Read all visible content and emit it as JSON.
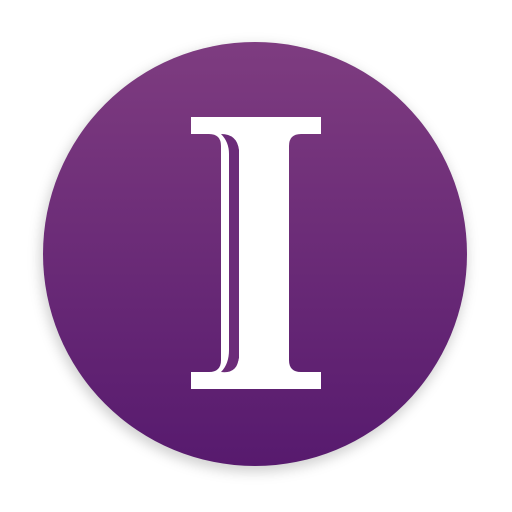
{
  "app_icon": {
    "letter": "I",
    "icon_name": "serif-capital-i-logo",
    "colors": {
      "badge_top": "#7e3c80",
      "badge_bottom": "#571a6e",
      "letter": "#ffffff",
      "background": "#ffffff"
    }
  }
}
